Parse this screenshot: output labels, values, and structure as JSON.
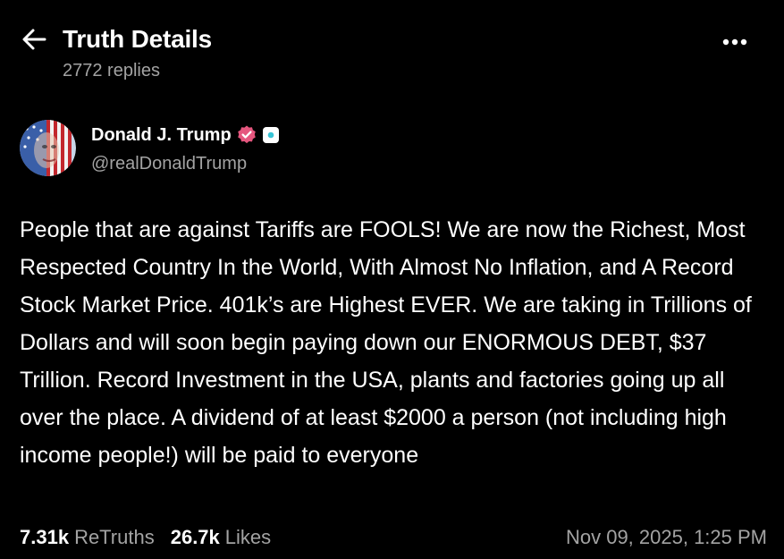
{
  "header": {
    "title": "Truth Details",
    "replies": "2772 replies",
    "back_icon": "arrow-left-icon",
    "more_icon": "more-horizontal-icon"
  },
  "author": {
    "name": "Donald J. Trump",
    "handle": "@realDonaldTrump",
    "verified_icon": "verified-badge-icon",
    "verified_color": "#e5567e",
    "affiliation_icon": "affiliation-badge-icon"
  },
  "post": {
    "text": "People that are against Tariffs are FOOLS! We are now the Richest, Most Respected Country In the World, With Almost No Inflation, and A Record Stock Market Price. 401k’s are Highest EVER. We are taking in Trillions of Dollars and will soon begin paying down our ENORMOUS DEBT, $37 Trillion. Record Investment in the USA, plants and factories going up all over the place. A dividend of at least $2000 a person (not including high income people!) will be paid to everyone"
  },
  "stats": {
    "retruths_count": "7.31k",
    "retruths_label": "ReTruths",
    "likes_count": "26.7k",
    "likes_label": "Likes",
    "timestamp": "Nov 09, 2025, 1:25 PM"
  },
  "colors": {
    "background": "#000000",
    "primary_text": "#ffffff",
    "secondary_text": "#a3a3a3"
  }
}
